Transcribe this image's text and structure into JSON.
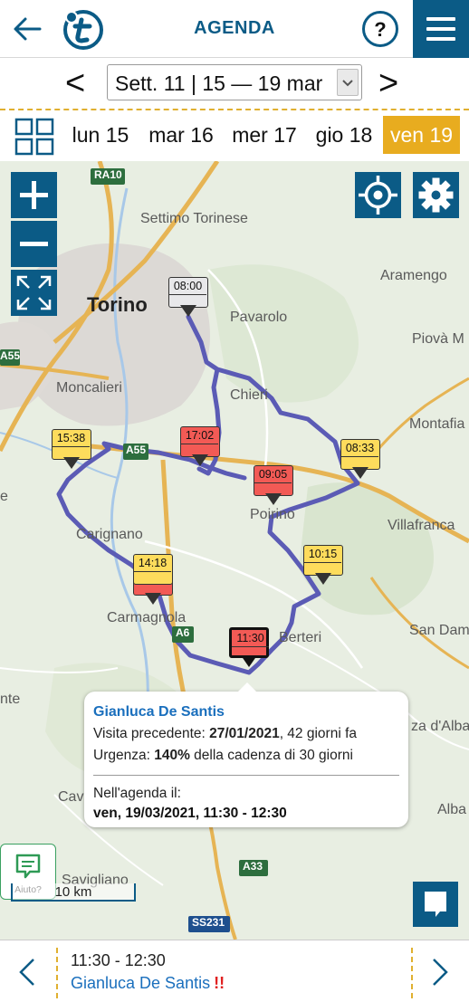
{
  "header": {
    "title": "AGENDA",
    "help_label": "?"
  },
  "week": {
    "prev_label": "<",
    "next_label": ">",
    "selected": "Sett. 11 | 15 — 19 mar"
  },
  "days": [
    {
      "label": "lun 15",
      "active": false
    },
    {
      "label": "mar 16",
      "active": false
    },
    {
      "label": "mer 17",
      "active": false
    },
    {
      "label": "gio 18",
      "active": false
    },
    {
      "label": "ven 19",
      "active": true
    }
  ],
  "map": {
    "places": {
      "torino": "Torino",
      "settimo": "Settimo Torinese",
      "ra10": "RA10",
      "a55": "A55",
      "a55b": "A55",
      "a6": "A6",
      "a33": "A33",
      "ss231": "SS231",
      "pavarolo": "Pavarolo",
      "chieri": "Chieri",
      "aramengo": "Aramengo",
      "piova": "Piovà M",
      "montafia": "Montafia",
      "villafranca": "Villafranca",
      "moncalieri": "Moncalieri",
      "carignano": "Carignano",
      "carmagnola": "Carmagnola",
      "poirino": "Poirino",
      "berteri": "Berteri",
      "sandam": "San Dam",
      "dalba": "za d'Alba",
      "alba": "Alba",
      "cav": "Cav",
      "savigliano": "Savigliano",
      "nte": "nte",
      "e": "e"
    },
    "markers": {
      "m0800": "08:00",
      "m0833": "08:33",
      "m0905": "09:05",
      "m1015": "10:15",
      "m1130": "11:30",
      "m1418": "14:18",
      "m1538": "15:38",
      "m1702": "17:02"
    },
    "colors": {
      "route": "#5b5bb5",
      "marker_red": "#f25a55",
      "marker_yellow": "#fddc5c",
      "marker_grey": "#e8e8ea",
      "brand": "#0b5b86",
      "accent": "#e8ac1f"
    },
    "scale_label": "10 km",
    "help_label": "Aiuto?"
  },
  "popup": {
    "client": "Gianluca De Santis",
    "prev_visit_label": "Visita precedente: ",
    "prev_visit_date": "27/01/2021",
    "prev_visit_rest": ", 42 giorni fa",
    "urgency_label": "Urgenza: ",
    "urgency_value": "140%",
    "urgency_rest": " della cadenza di 30 giorni",
    "agenda_label": "Nell'agenda il:",
    "agenda_value": "ven, 19/03/2021, 11:30 - 12:30"
  },
  "bottom": {
    "time": "11:30 - 12:30",
    "client": "Gianluca De Santis",
    "urgency_mark": "!!"
  }
}
